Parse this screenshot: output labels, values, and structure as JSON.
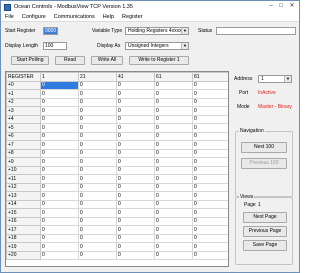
{
  "window": {
    "title": "Ocean Controls - ModbusView TCP Version 1.35",
    "minimize": "–",
    "maximize": "□",
    "close": "✕"
  },
  "menu": [
    "File",
    "Configure",
    "Communications",
    "Help",
    "Register"
  ],
  "form": {
    "start_register_label": "Start Register",
    "start_register_value": "0000",
    "variable_type_label": "Variable Type",
    "variable_type_value": "Holding Registers 4xxxx",
    "status_label": "Status",
    "status_value": "",
    "display_length_label": "Display Length",
    "display_length_value": "100",
    "display_as_label": "Display As",
    "display_as_value": "Unsigned Integers"
  },
  "buttons": {
    "start_polling": "Start Polling",
    "read": "Read",
    "write_all": "Write All",
    "write_to_register": "Write to Register 1"
  },
  "grid": {
    "headers": [
      "REGISTER",
      "1",
      "21",
      "41",
      "61",
      "81"
    ],
    "rows": [
      [
        "+0",
        "0",
        "0",
        "0",
        "0",
        "0"
      ],
      [
        "+1",
        "0",
        "0",
        "0",
        "0",
        "0"
      ],
      [
        "+2",
        "0",
        "0",
        "0",
        "0",
        "0"
      ],
      [
        "+3",
        "0",
        "0",
        "0",
        "0",
        "0"
      ],
      [
        "+4",
        "0",
        "0",
        "0",
        "0",
        "0"
      ],
      [
        "+5",
        "0",
        "0",
        "0",
        "0",
        "0"
      ],
      [
        "+6",
        "0",
        "0",
        "0",
        "0",
        "0"
      ],
      [
        "+7",
        "0",
        "0",
        "0",
        "0",
        "0"
      ],
      [
        "+8",
        "0",
        "0",
        "0",
        "0",
        "0"
      ],
      [
        "+9",
        "0",
        "0",
        "0",
        "0",
        "0"
      ],
      [
        "+10",
        "0",
        "0",
        "0",
        "0",
        "0"
      ],
      [
        "+11",
        "0",
        "0",
        "0",
        "0",
        "0"
      ],
      [
        "+12",
        "0",
        "0",
        "0",
        "0",
        "0"
      ],
      [
        "+13",
        "0",
        "0",
        "0",
        "0",
        "0"
      ],
      [
        "+14",
        "0",
        "0",
        "0",
        "0",
        "0"
      ],
      [
        "+15",
        "0",
        "0",
        "0",
        "0",
        "0"
      ],
      [
        "+16",
        "0",
        "0",
        "0",
        "0",
        "0"
      ],
      [
        "+17",
        "0",
        "0",
        "0",
        "0",
        "0"
      ],
      [
        "+18",
        "0",
        "0",
        "0",
        "0",
        "0"
      ],
      [
        "+19",
        "0",
        "0",
        "0",
        "0",
        "0"
      ],
      [
        "+20",
        "0",
        "0",
        "0",
        "0",
        "0"
      ]
    ]
  },
  "side": {
    "address_label": "Address",
    "address_value": "1",
    "port_label": "Port",
    "port_value": "InActive",
    "mode_label": "Mode",
    "mode_value": "Master - Binary",
    "navigation_title": "Navigation",
    "next_100": "Next 100",
    "previous_100": "Previous 100",
    "views_title": "Views",
    "page_label": "Page",
    "page_value": "1",
    "next_page": "Next Page",
    "previous_page": "Previous Page",
    "save_page": "Save Page"
  },
  "colors": {
    "accent_red": "#e02020",
    "selection_blue": "#2f7be0"
  }
}
